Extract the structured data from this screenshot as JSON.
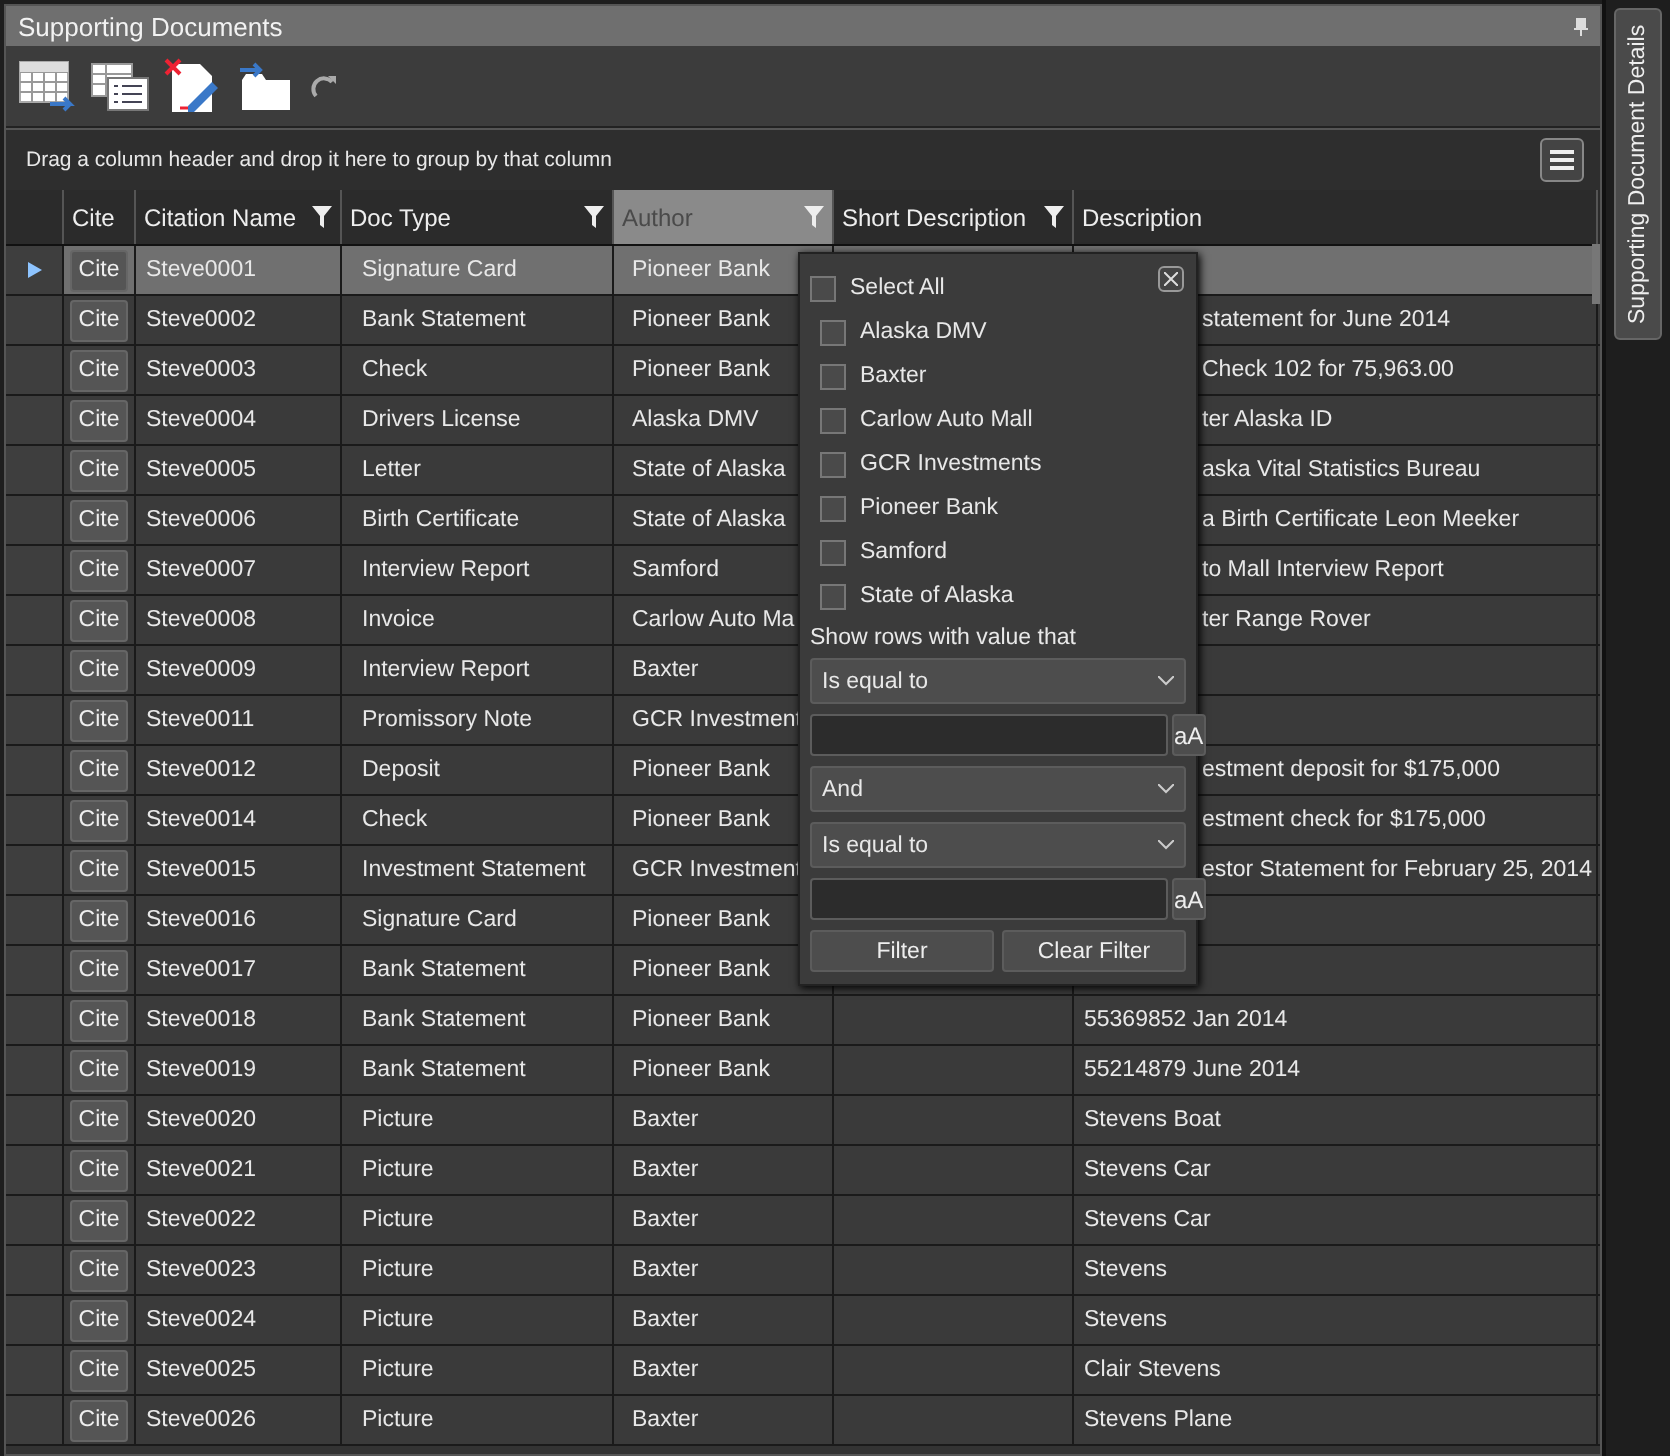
{
  "panel": {
    "title": "Supporting Documents"
  },
  "group_hint": "Drag a column header and drop it here to group by that column",
  "side_tab": {
    "label": "Supporting Document Details"
  },
  "table": {
    "columns": [
      {
        "label": "Cite",
        "filterable": false,
        "filter_open": false
      },
      {
        "label": "Citation Name",
        "filterable": true,
        "filter_open": false
      },
      {
        "label": "Doc Type",
        "filterable": true,
        "filter_open": false
      },
      {
        "label": "Author",
        "filterable": true,
        "filter_open": true
      },
      {
        "label": "Short Description",
        "filterable": true,
        "filter_open": false
      },
      {
        "label": "Description",
        "filterable": false,
        "filter_open": false
      }
    ],
    "rows": [
      {
        "cite": "Cite",
        "name": "Steve0001",
        "type": "Signature Card",
        "author": "Pioneer Bank",
        "description": "",
        "selected": true
      },
      {
        "cite": "Cite",
        "name": "Steve0002",
        "type": "Bank Statement",
        "author": "Pioneer Bank",
        "description": "statement for June 2014",
        "selected": false
      },
      {
        "cite": "Cite",
        "name": "Steve0003",
        "type": "Check",
        "author": "Pioneer Bank",
        "description": "Check 102 for 75,963.00",
        "selected": false
      },
      {
        "cite": "Cite",
        "name": "Steve0004",
        "type": "Drivers License",
        "author": "Alaska DMV",
        "description": "ter Alaska ID",
        "selected": false
      },
      {
        "cite": "Cite",
        "name": "Steve0005",
        "type": "Letter",
        "author": "State of Alaska",
        "description": "aska Vital Statistics Bureau",
        "selected": false
      },
      {
        "cite": "Cite",
        "name": "Steve0006",
        "type": "Birth Certificate",
        "author": "State of Alaska",
        "description": "a Birth Certificate Leon Meeker",
        "selected": false
      },
      {
        "cite": "Cite",
        "name": "Steve0007",
        "type": "Interview Report",
        "author": "Samford",
        "description": "to Mall Interview Report",
        "selected": false
      },
      {
        "cite": "Cite",
        "name": "Steve0008",
        "type": "Invoice",
        "author": "Carlow Auto Ma",
        "description": "ter Range Rover",
        "selected": false
      },
      {
        "cite": "Cite",
        "name": "Steve0009",
        "type": "Interview Report",
        "author": "Baxter",
        "description": "",
        "selected": false
      },
      {
        "cite": "Cite",
        "name": "Steve0011",
        "type": "Promissory Note",
        "author": "GCR Investment",
        "description": "",
        "selected": false
      },
      {
        "cite": "Cite",
        "name": "Steve0012",
        "type": "Deposit",
        "author": "Pioneer Bank",
        "description": "estment deposit for $175,000",
        "selected": false
      },
      {
        "cite": "Cite",
        "name": "Steve0014",
        "type": "Check",
        "author": "Pioneer Bank",
        "description": "estment check for $175,000",
        "selected": false
      },
      {
        "cite": "Cite",
        "name": "Steve0015",
        "type": "Investment Statement",
        "author": "GCR Investment",
        "description": "estor Statement for February 25, 2014",
        "selected": false
      },
      {
        "cite": "Cite",
        "name": "Steve0016",
        "type": "Signature Card",
        "author": "Pioneer Bank",
        "description": "",
        "selected": false
      },
      {
        "cite": "Cite",
        "name": "Steve0017",
        "type": "Bank Statement",
        "author": "Pioneer Bank",
        "description": "",
        "selected": false
      },
      {
        "cite": "Cite",
        "name": "Steve0018",
        "type": "Bank Statement",
        "author": "Pioneer Bank",
        "description": "55369852 Jan 2014",
        "selected": false
      },
      {
        "cite": "Cite",
        "name": "Steve0019",
        "type": "Bank Statement",
        "author": "Pioneer Bank",
        "description": "55214879 June 2014",
        "selected": false
      },
      {
        "cite": "Cite",
        "name": "Steve0020",
        "type": "Picture",
        "author": "Baxter",
        "description": "Stevens Boat",
        "selected": false
      },
      {
        "cite": "Cite",
        "name": "Steve0021",
        "type": "Picture",
        "author": "Baxter",
        "description": "Stevens Car",
        "selected": false
      },
      {
        "cite": "Cite",
        "name": "Steve0022",
        "type": "Picture",
        "author": "Baxter",
        "description": "Stevens Car",
        "selected": false
      },
      {
        "cite": "Cite",
        "name": "Steve0023",
        "type": "Picture",
        "author": "Baxter",
        "description": "Stevens",
        "selected": false
      },
      {
        "cite": "Cite",
        "name": "Steve0024",
        "type": "Picture",
        "author": "Baxter",
        "description": "Stevens",
        "selected": false
      },
      {
        "cite": "Cite",
        "name": "Steve0025",
        "type": "Picture",
        "author": "Baxter",
        "description": "Clair Stevens",
        "selected": false
      },
      {
        "cite": "Cite",
        "name": "Steve0026",
        "type": "Picture",
        "author": "Baxter",
        "description": "Stevens Plane",
        "selected": false
      }
    ]
  },
  "filter_popup": {
    "select_all": {
      "label": "Select All",
      "checked": false
    },
    "values": [
      {
        "label": "Alaska DMV",
        "checked": false
      },
      {
        "label": "Baxter",
        "checked": false
      },
      {
        "label": "Carlow Auto Mall",
        "checked": false
      },
      {
        "label": "GCR Investments",
        "checked": false
      },
      {
        "label": "Pioneer Bank",
        "checked": false
      },
      {
        "label": "Samford",
        "checked": false
      },
      {
        "label": "State of Alaska",
        "checked": false
      }
    ],
    "condition_label": "Show rows with value that",
    "operator_1": "Is equal to",
    "case_button_1": "aA",
    "logic": "And",
    "operator_2": "Is equal to",
    "case_button_2": "aA",
    "buttons": [
      "Filter",
      "Clear Filter"
    ]
  }
}
